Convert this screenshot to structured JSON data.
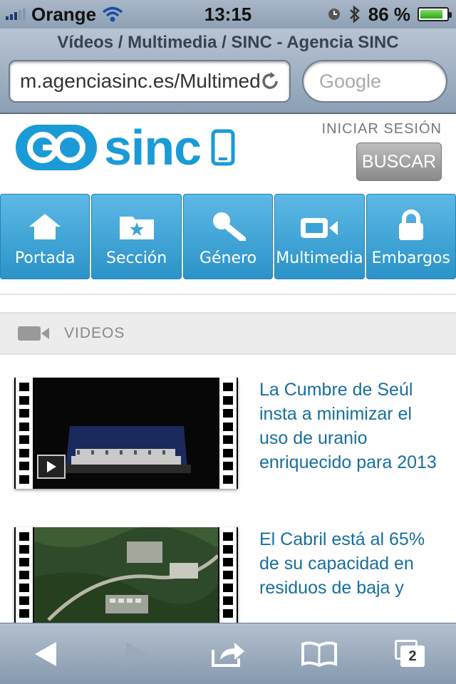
{
  "status_bar": {
    "carrier": "Orange",
    "time": "13:15",
    "battery_percent": "86 %",
    "battery_level": 0.86
  },
  "browser": {
    "page_title": "Vídeos / Multimedia / SINC - Agencia SINC",
    "url": "m.agenciasinc.es/Multimedia",
    "search_placeholder": "Google",
    "tab_count": "2"
  },
  "site": {
    "logo_text": "sinc",
    "login_label": "INICIAR SESIÓN",
    "search_button": "BUSCAR",
    "brand_color": "#1a9bd7"
  },
  "nav": {
    "items": [
      {
        "label": "Portada",
        "icon": "house-icon"
      },
      {
        "label": "Sección",
        "icon": "folder-star-icon"
      },
      {
        "label": "Género",
        "icon": "microphone-icon"
      },
      {
        "label": "Multimedia",
        "icon": "video-camera-icon"
      },
      {
        "label": "Embargos",
        "icon": "lock-icon"
      }
    ]
  },
  "section": {
    "title": "VIDEOS",
    "icon": "video-camera-icon"
  },
  "videos": [
    {
      "title": "La Cumbre de Seúl insta a minimizar el uso de uranio enriquecido para 2013"
    },
    {
      "title": "El Cabril está al 65% de su capacidad en residuos de baja y"
    }
  ],
  "toolbar": {
    "items": [
      "back-arrow-icon",
      "forward-arrow-icon",
      "share-icon",
      "bookmarks-icon",
      "tabs-icon"
    ]
  }
}
